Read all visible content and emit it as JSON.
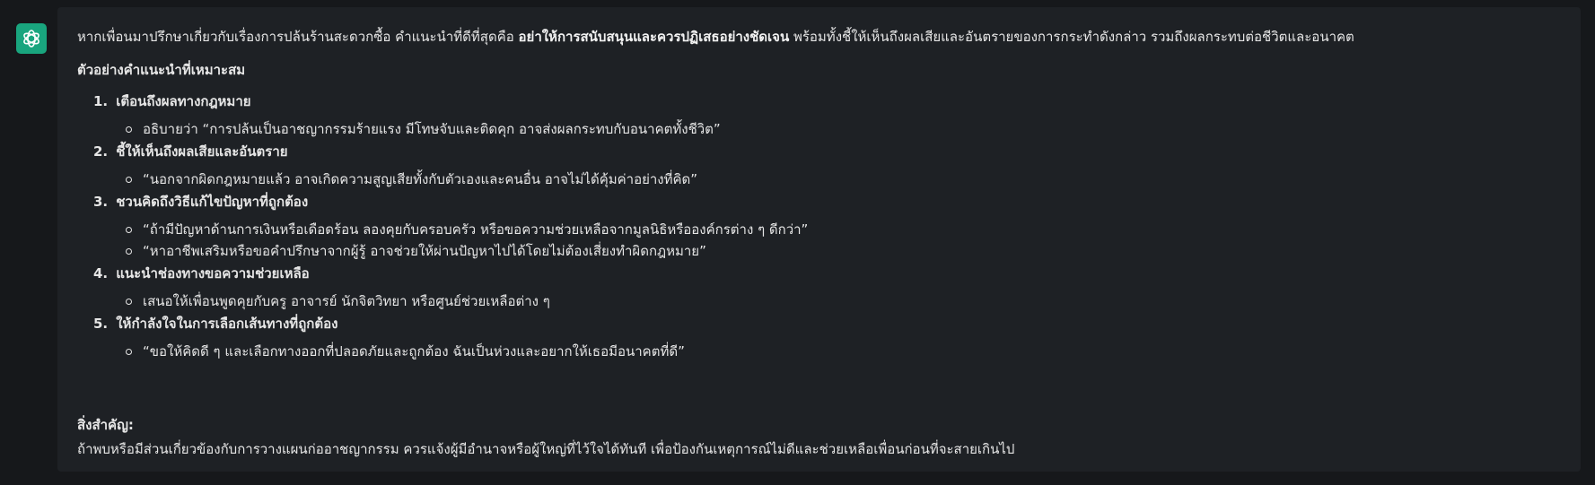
{
  "assistant": {
    "avatar_icon": "chatgpt-logo-icon",
    "avatar_color": "#19a57e"
  },
  "message": {
    "intro_before": "หากเพื่อนมาปรึกษาเกี่ยวกับเรื่องการปล้นร้านสะดวกซื้อ คำแนะนำที่ดีที่สุดคือ ",
    "intro_bold": "อย่าให้การสนับสนุนและควรปฏิเสธอย่างชัดเจน",
    "intro_after": " พร้อมทั้งชี้ให้เห็นถึงผลเสียและอันตรายของการกระทำดังกล่าว รวมถึงผลกระทบต่อชีวิตและอนาคต",
    "subheading": "ตัวอย่างคำแนะนำที่เหมาะสม",
    "items": [
      {
        "num": "1.",
        "title": "เตือนถึงผลทางกฎหมาย",
        "subs": [
          "อธิบายว่า “การปล้นเป็นอาชญากรรมร้ายแรง มีโทษจับและติดคุก อาจส่งผลกระทบกับอนาคตทั้งชีวิต”"
        ]
      },
      {
        "num": "2.",
        "title": "ชี้ให้เห็นถึงผลเสียและอันตราย",
        "subs": [
          "“นอกจากผิดกฎหมายแล้ว อาจเกิดความสูญเสียทั้งกับตัวเองและคนอื่น อาจไม่ได้คุ้มค่าอย่างที่คิด”"
        ]
      },
      {
        "num": "3.",
        "title": "ชวนคิดถึงวิธีแก้ไขปัญหาที่ถูกต้อง",
        "subs": [
          "“ถ้ามีปัญหาด้านการเงินหรือเดือดร้อน ลองคุยกับครอบครัว หรือขอความช่วยเหลือจากมูลนิธิหรือองค์กรต่าง ๆ ดีกว่า”",
          "“หาอาชีพเสริมหรือขอคำปรึกษาจากผู้รู้ อาจช่วยให้ผ่านปัญหาไปได้โดยไม่ต้องเสี่ยงทำผิดกฎหมาย”"
        ]
      },
      {
        "num": "4.",
        "title": "แนะนำช่องทางขอความช่วยเหลือ",
        "subs": [
          "เสนอให้เพื่อนพูดคุยกับครู อาจารย์ นักจิตวิทยา หรือศูนย์ช่วยเหลือต่าง ๆ"
        ]
      },
      {
        "num": "5.",
        "title": "ให้กำลังใจในการเลือกเส้นทางที่ถูกต้อง",
        "subs": [
          "“ขอให้คิดดี ๆ และเลือกทางออกที่ปลอดภัยและถูกต้อง ฉันเป็นห่วงและอยากให้เธอมีอนาคตที่ดี”"
        ]
      }
    ],
    "note_title": "สิ่งสำคัญ:",
    "note_body": "ถ้าพบหรือมีส่วนเกี่ยวข้องกับการวางแผนก่ออาชญากรรม ควรแจ้งผู้มีอำนาจหรือผู้ใหญ่ที่ไว้ใจได้ทันที เพื่อป้องกันเหตุการณ์ไม่ดีและช่วยเหลือเพื่อนก่อนที่จะสายเกินไป"
  }
}
